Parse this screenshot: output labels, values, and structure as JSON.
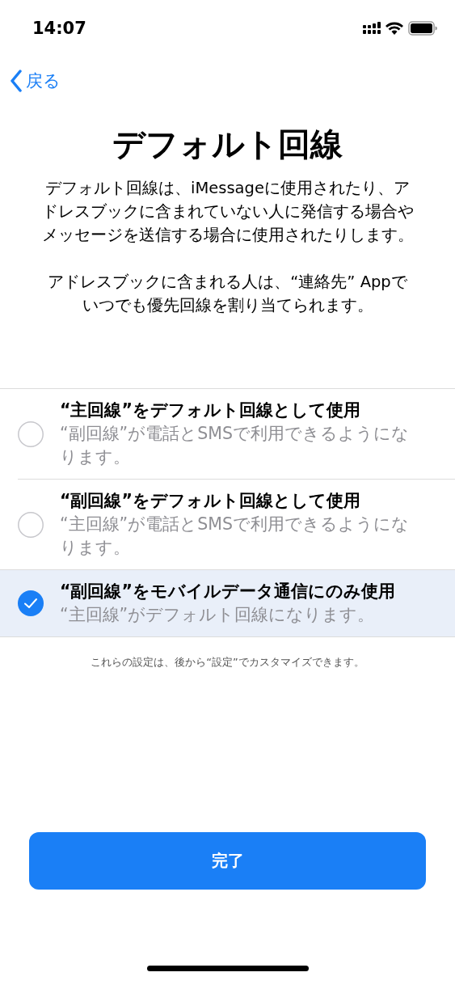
{
  "status_bar": {
    "time": "14:07"
  },
  "nav": {
    "back": "戻る"
  },
  "title": "デフォルト回線",
  "paragraphs": [
    "デフォルト回線は、iMessageに使用されたり、アドレスブックに含まれていない人に発信する場合やメッセージを送信する場合に使用されたりします。",
    "アドレスブックに含まれる人は、“連絡先” Appでいつでも優先回線を割り当てられます。"
  ],
  "options": [
    {
      "title": "“主回線”をデフォルト回線として使用",
      "description": "“副回線”が電話とSMSで利用できるようになります。",
      "selected": false
    },
    {
      "title": "“副回線”をデフォルト回線として使用",
      "description": "“主回線”が電話とSMSで利用できるようになります。",
      "selected": false
    },
    {
      "title": "“副回線”をモバイルデータ通信にのみ使用",
      "description": "“主回線”がデフォルト回線になります。",
      "selected": true
    }
  ],
  "footnote": "これらの設定は、後から“設定”でカスタマイズできます。",
  "done_button": "完了"
}
